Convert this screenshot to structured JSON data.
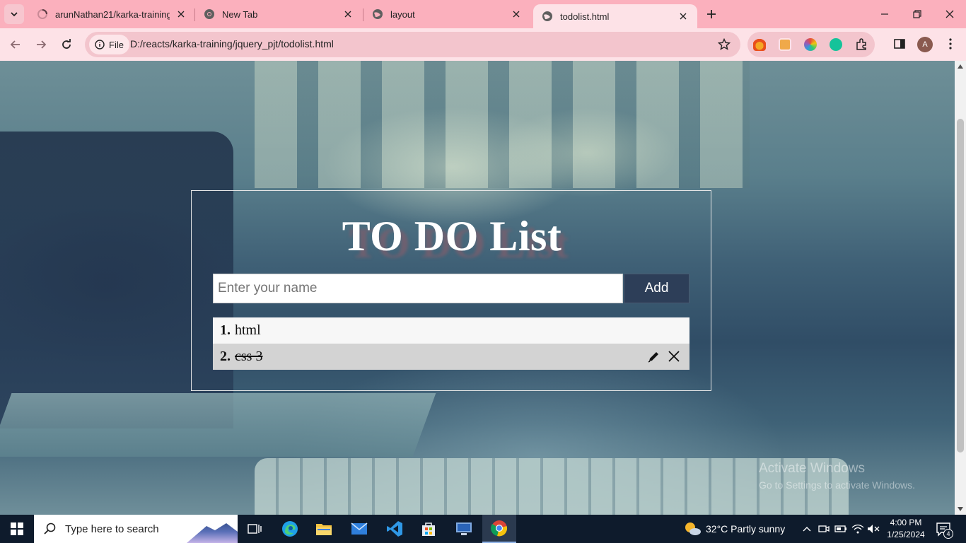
{
  "browser": {
    "tabs": [
      {
        "title": "arunNathan21/karka-training at",
        "icon": "github-loading-icon"
      },
      {
        "title": "New Tab",
        "icon": "chrome-icon"
      },
      {
        "title": "layout",
        "icon": "globe-icon"
      },
      {
        "title": "todolist.html",
        "icon": "globe-icon",
        "active": true
      }
    ],
    "omnibox": {
      "chip_label": "File",
      "url": "D:/reacts/karka-training/jquery_pjt/todolist.html"
    },
    "profile_initial": "A"
  },
  "page": {
    "title": "TO DO List",
    "input": {
      "placeholder": "Enter your name",
      "value": ""
    },
    "add_label": "Add",
    "items": [
      {
        "num": "1.",
        "text": "html",
        "done": false
      },
      {
        "num": "2.",
        "text": "css 3",
        "done": true
      }
    ],
    "watermark": {
      "line1": "Activate Windows",
      "line2": "Go to Settings to activate Windows."
    }
  },
  "taskbar": {
    "search_placeholder": "Type here to search",
    "weather": "32°C  Partly sunny",
    "time": "4:00 PM",
    "date": "1/25/2024",
    "notification_count": "4"
  },
  "colors": {
    "tab_strip": "#fbb0bd",
    "toolbar": "#fde2e7",
    "add_button": "#2d3e58",
    "taskbar": "#0e1b2c"
  }
}
